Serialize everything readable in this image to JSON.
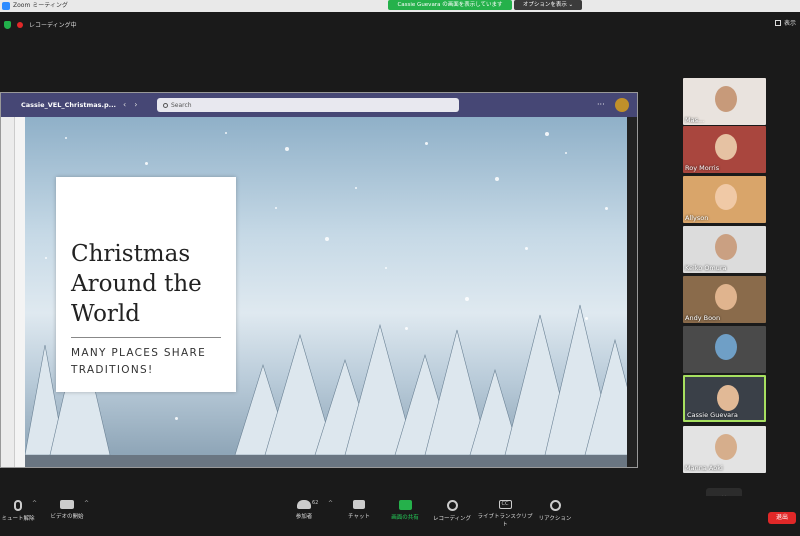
{
  "titlebar": {
    "app_title": "Zoom ミーティング",
    "share_banner": "Cassie Guevara の画面を表示しています",
    "options_button": "オプションを表示 ⌄"
  },
  "meeting": {
    "recording_status": "レコーディング中",
    "view_button": "表示"
  },
  "shared_screen": {
    "file_name": "Cassie_VEL_Christmas.p...",
    "search_placeholder": "Search",
    "slide": {
      "title": "Christmas Around the World",
      "subtitle": "MANY PLACES SHARE TRADITIONS!"
    }
  },
  "gallery": {
    "participants": [
      {
        "name": "Mas...",
        "bg": "#e9e3de",
        "face": "#c79a7a"
      },
      {
        "name": "Roy Morris",
        "bg": "#a9463e",
        "face": "#e6c2a3"
      },
      {
        "name": "Allyson",
        "bg": "#d9a56a",
        "face": "#f0c9a6"
      },
      {
        "name": "Keiko Omura",
        "bg": "#dcdcdc",
        "face": "#caa082"
      },
      {
        "name": "Andy Boon",
        "bg": "#8a6b4b",
        "face": "#e0b48e"
      },
      {
        "name": "",
        "bg": "#4a4a4a",
        "face": "#6f9fc6"
      },
      {
        "name": "Cassie Guevara",
        "bg": "#3a4048",
        "face": "#e1b996"
      },
      {
        "name": "Manna Aoki",
        "bg": "#e3e3e3",
        "face": "#d6ae8c"
      }
    ]
  },
  "toolbar": {
    "mute": "ミュート解除",
    "video": "ビデオの開始",
    "participants": "参加者",
    "participants_count": "62",
    "chat": "チャット",
    "share": "画面の共有",
    "record": "レコーディング",
    "transcript": "ライブトランスクリプト",
    "reactions": "リアクション",
    "leave": "退出"
  },
  "colors": {
    "share_green": "#25b14b",
    "leave_red": "#e02828",
    "teams_purple": "#464775",
    "active_speaker": "#a7e060"
  }
}
